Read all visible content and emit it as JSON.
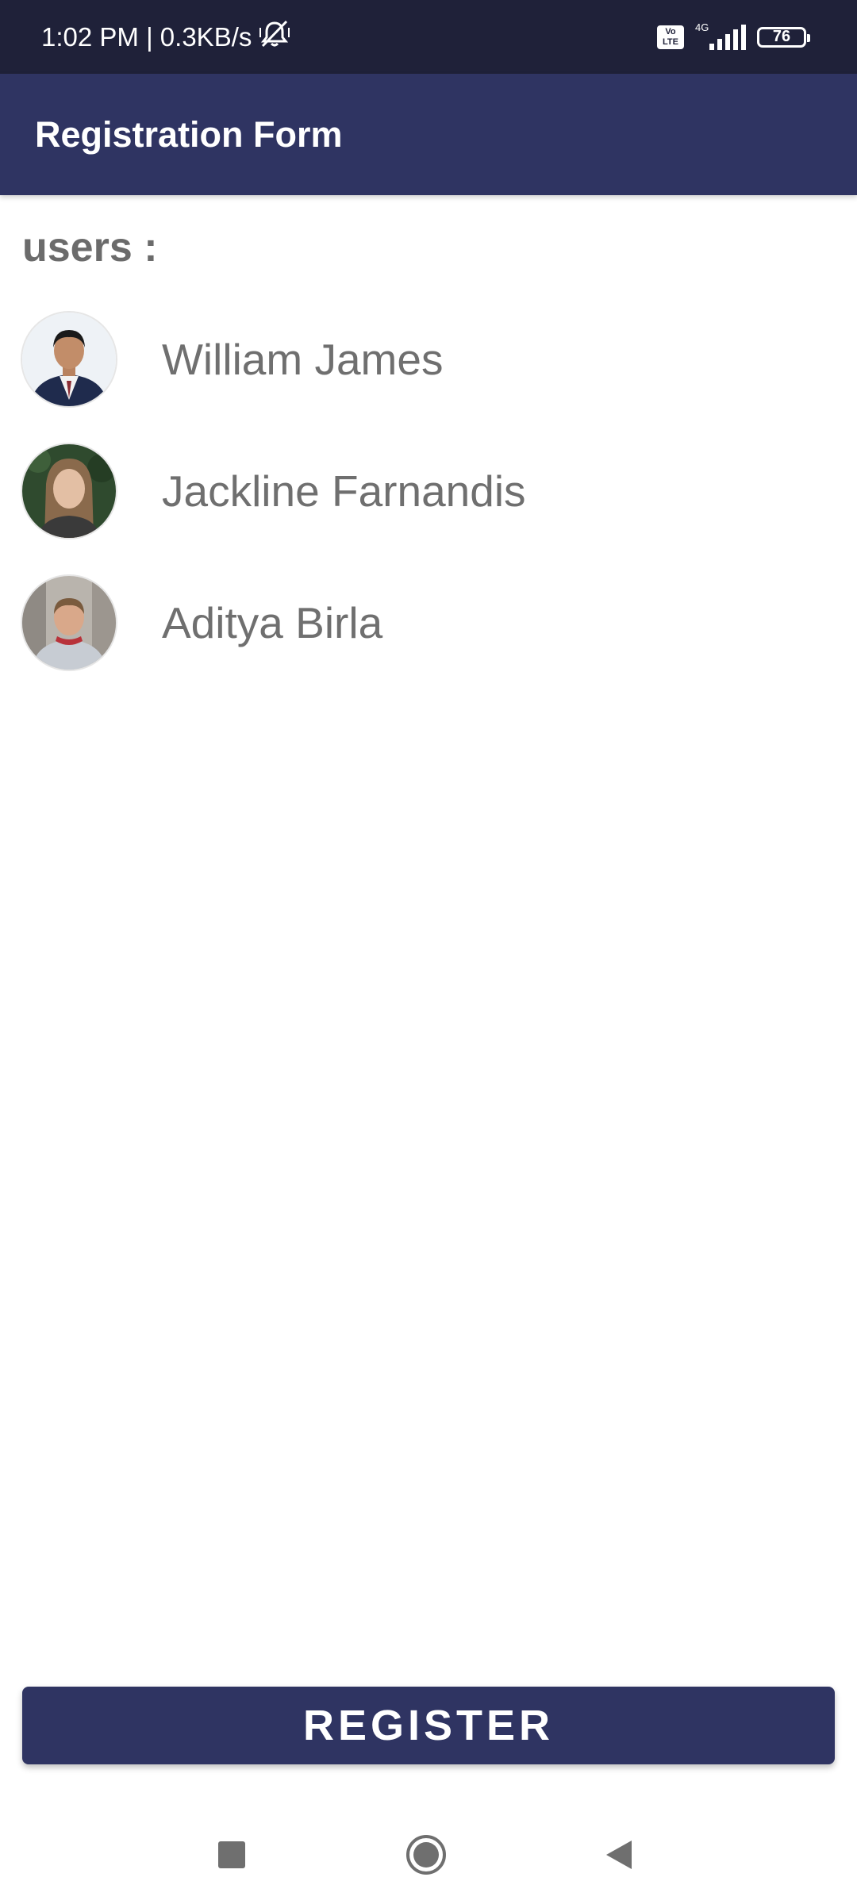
{
  "status_bar": {
    "time_speed": "1:02 PM | 0.3KB/s",
    "volte_top": "Vo",
    "volte_bottom": "LTE",
    "network_type": "4G",
    "battery": "76",
    "icons": [
      "mute-bell-icon",
      "volte-icon",
      "signal-icon",
      "battery-icon"
    ]
  },
  "app_bar": {
    "title": "Registration Form"
  },
  "main": {
    "section_label": "users :",
    "users": [
      {
        "name": "William James",
        "avatar": "avatar-photo-man-suit"
      },
      {
        "name": "Jackline Farnandis",
        "avatar": "avatar-photo-woman"
      },
      {
        "name": "Aditya Birla",
        "avatar": "avatar-photo-man-jacket"
      }
    ]
  },
  "actions": {
    "register_label": "REGISTER"
  },
  "nav_bar": {
    "icons": [
      "recent-apps-icon",
      "home-icon",
      "back-icon"
    ]
  },
  "colors": {
    "status_bar_bg": "#1f2139",
    "primary": "#2f3462",
    "text_muted": "#6f6f6f"
  }
}
